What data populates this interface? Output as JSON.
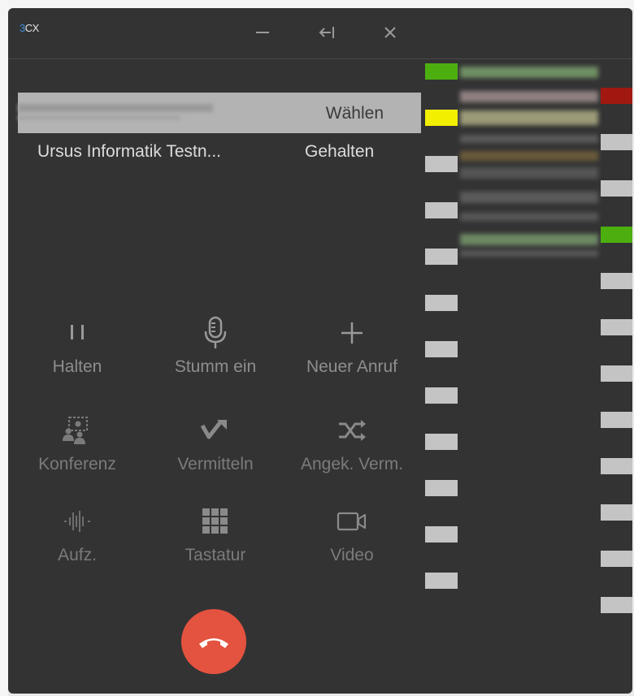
{
  "app": {
    "logo_number": "3",
    "logo_text": "CX"
  },
  "titlebar": {
    "minimize_icon": "minimize-icon",
    "dock_icon": "dock-left-icon",
    "close_icon": "close-icon"
  },
  "calls": {
    "active": {
      "status": "Wählen"
    },
    "held": {
      "name": "Ursus Informatik Testn...",
      "status": "Gehalten"
    }
  },
  "actions": [
    {
      "label": "Halten",
      "icon": "pause-icon"
    },
    {
      "label": "Stumm ein",
      "icon": "microphone-icon"
    },
    {
      "label": "Neuer Anruf",
      "icon": "plus-icon"
    },
    {
      "label": "Konferenz",
      "icon": "conference-icon"
    },
    {
      "label": "Vermitteln",
      "icon": "transfer-icon"
    },
    {
      "label": "Angek. Verm.",
      "icon": "attended-transfer-icon"
    },
    {
      "label": "Aufz.",
      "icon": "record-icon"
    },
    {
      "label": "Tastatur",
      "icon": "dialpad-icon"
    },
    {
      "label": "Video",
      "icon": "video-icon"
    }
  ],
  "hangup": {
    "icon": "hangup-icon"
  },
  "colors": {
    "window_bg": "#333334",
    "hangup_red": "#e4533f",
    "blf_green": "#4caf0f",
    "blf_yellow": "#f2f000",
    "blf_red": "#a0180f",
    "blf_idle": "#c4c4c4"
  },
  "blf_left_states": [
    "green",
    "yellow",
    "idle",
    "idle",
    "idle",
    "idle",
    "idle",
    "idle",
    "idle",
    "idle",
    "idle",
    "idle"
  ],
  "blf_right_states": [
    "red",
    "idle",
    "idle",
    "green",
    "idle",
    "idle",
    "idle",
    "idle",
    "idle",
    "idle",
    "idle",
    "idle"
  ]
}
